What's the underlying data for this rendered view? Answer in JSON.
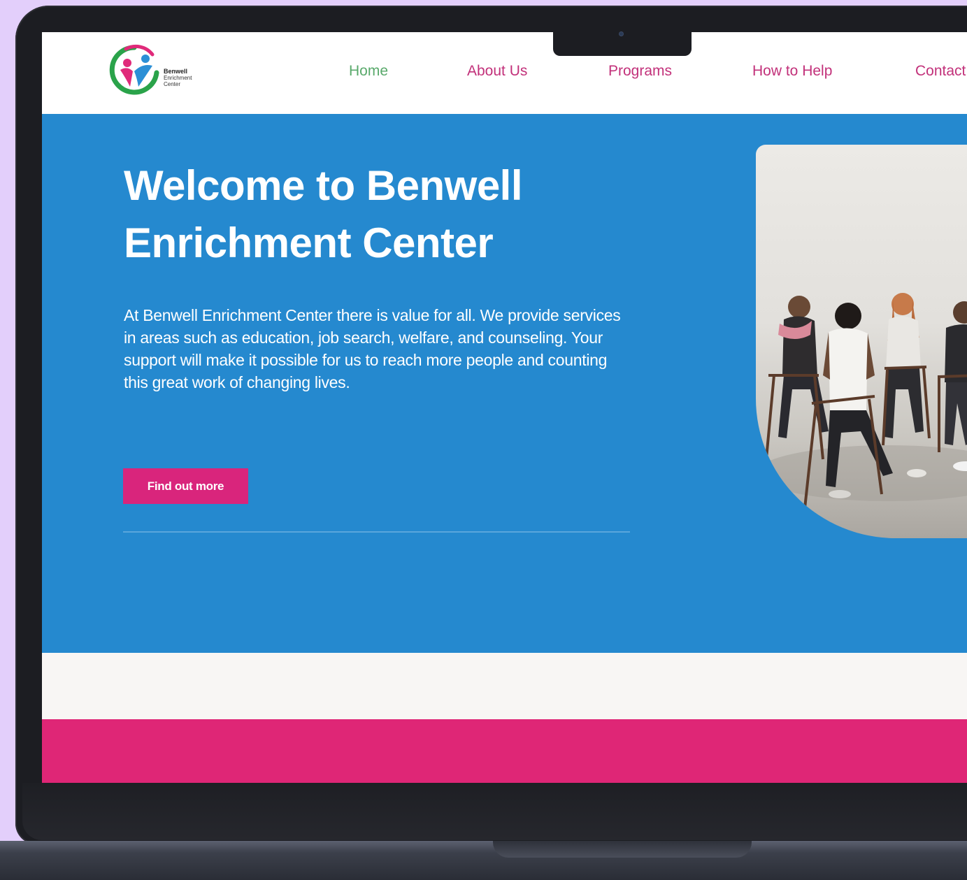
{
  "brand": {
    "line1": "Benwell",
    "line2": "Enrichment",
    "line3": "Center"
  },
  "nav": {
    "home": "Home",
    "about": "About Us",
    "programs": "Programs",
    "help": "How to Help",
    "contact": "Contact"
  },
  "hero": {
    "title": "Welcome to Benwell Enrichment Center",
    "description": "At Benwell Enrichment Center there is value for all. We provide services in areas such as education, job search, welfare, and counseling. Your support will make it possible for us to reach more people and counting this great work of changing lives.",
    "cta_label": "Find out more",
    "photo": "group-therapy-circle-photo"
  },
  "colors": {
    "hero_bg": "#2589cf",
    "accent_pink": "#df2676",
    "nav_active": "#59a96b",
    "nav_link": "#c2317a",
    "background": "#e3cffb"
  }
}
